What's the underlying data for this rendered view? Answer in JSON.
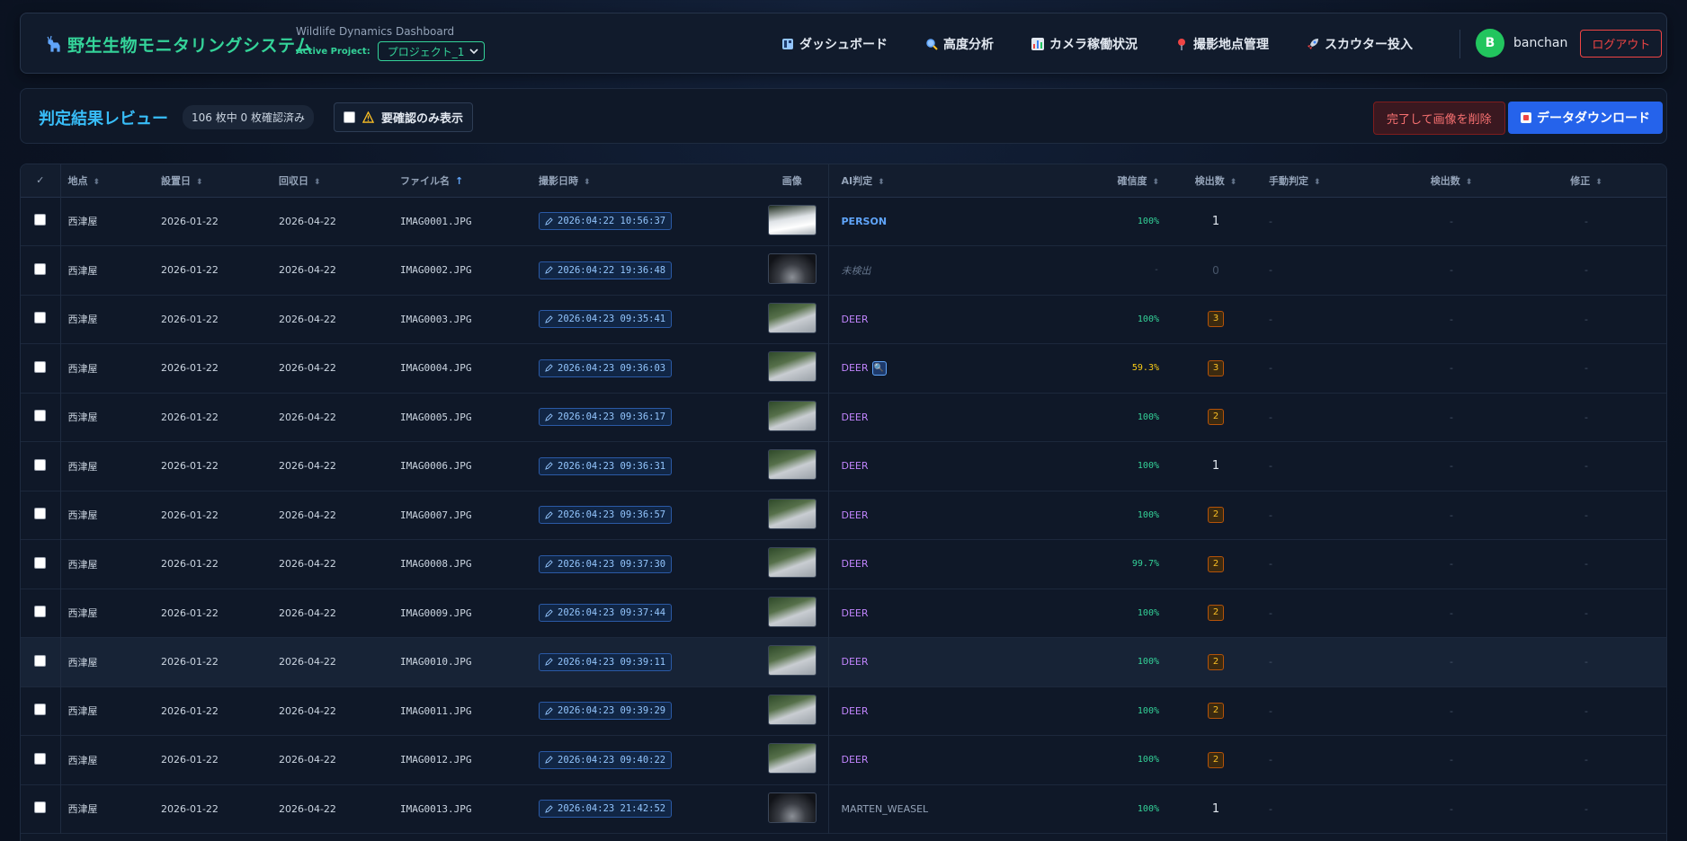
{
  "header": {
    "brand_title": "野生生物モニタリングシステム",
    "subtitle": "Wildlife Dynamics Dashboard",
    "project_label": "Active Project:",
    "project_value": "プロジェクト_1",
    "nav": [
      {
        "label": "ダッシュボード",
        "icon": "dashboard-icon"
      },
      {
        "label": "高度分析",
        "icon": "magnifier-icon"
      },
      {
        "label": "カメラ稼働状況",
        "icon": "bar-chart-icon"
      },
      {
        "label": "撮影地点管理",
        "icon": "location-pin-icon"
      },
      {
        "label": "スカウター投入",
        "icon": "rocket-icon"
      }
    ],
    "avatar_initial": "B",
    "username": "banchan",
    "logout_label": "ログアウト"
  },
  "toolbar": {
    "title": "判定結果レビュー",
    "count_text": "106 枚中 0 枚確認済み",
    "filter_label": "要確認のみ表示",
    "delete_label": "完了して画像を削除",
    "download_label": "データダウンロード"
  },
  "table": {
    "columns": {
      "check": "✓",
      "location": "地点",
      "install_date": "設置日",
      "collect_date": "回収日",
      "filename": "ファイル名",
      "shot_time": "撮影日時",
      "image": "画像",
      "ai": "AI判定",
      "confidence": "確信度",
      "detections": "検出数",
      "manual": "手動判定",
      "manual_detections": "検出数",
      "fix": "修正"
    },
    "rows": [
      {
        "location": "西津屋",
        "install": "2026-01-22",
        "collect": "2026-04-22",
        "file": "IMAG0001.JPG",
        "time": "2026:04:22 10:56:37",
        "thumb": "light",
        "ai": "PERSON",
        "ai_class": "ai-person",
        "conf": "100%",
        "conf_class": "conf-hi",
        "count": "1",
        "count_type": "plain",
        "manual": "-",
        "manual_count": "-",
        "fix": "-"
      },
      {
        "location": "西津屋",
        "install": "2026-01-22",
        "collect": "2026-04-22",
        "file": "IMAG0002.JPG",
        "time": "2026:04:22 19:36:48",
        "thumb": "night",
        "ai": "未検出",
        "ai_class": "ai-none",
        "conf": "-",
        "conf_class": "conf-none",
        "count": "0",
        "count_type": "zero",
        "manual": "-",
        "manual_count": "-",
        "fix": "-"
      },
      {
        "location": "西津屋",
        "install": "2026-01-22",
        "collect": "2026-04-22",
        "file": "IMAG0003.JPG",
        "time": "2026:04:23 09:35:41",
        "thumb": "day",
        "ai": "DEER",
        "ai_class": "ai-deer",
        "conf": "100%",
        "conf_class": "conf-hi",
        "count": "3",
        "count_type": "badge",
        "manual": "-",
        "manual_count": "-",
        "fix": "-"
      },
      {
        "location": "西津屋",
        "install": "2026-01-22",
        "collect": "2026-04-22",
        "file": "IMAG0004.JPG",
        "time": "2026:04:23 09:36:03",
        "thumb": "day",
        "ai": "DEER",
        "ai_class": "ai-deer",
        "zoom": true,
        "conf": "59.3%",
        "conf_class": "conf-mid",
        "count": "3",
        "count_type": "badge",
        "manual": "-",
        "manual_count": "-",
        "fix": "-"
      },
      {
        "location": "西津屋",
        "install": "2026-01-22",
        "collect": "2026-04-22",
        "file": "IMAG0005.JPG",
        "time": "2026:04:23 09:36:17",
        "thumb": "day",
        "ai": "DEER",
        "ai_class": "ai-deer",
        "conf": "100%",
        "conf_class": "conf-hi",
        "count": "2",
        "count_type": "badge",
        "manual": "-",
        "manual_count": "-",
        "fix": "-"
      },
      {
        "location": "西津屋",
        "install": "2026-01-22",
        "collect": "2026-04-22",
        "file": "IMAG0006.JPG",
        "time": "2026:04:23 09:36:31",
        "thumb": "day",
        "ai": "DEER",
        "ai_class": "ai-deer",
        "conf": "100%",
        "conf_class": "conf-hi",
        "count": "1",
        "count_type": "plain",
        "manual": "-",
        "manual_count": "-",
        "fix": "-"
      },
      {
        "location": "西津屋",
        "install": "2026-01-22",
        "collect": "2026-04-22",
        "file": "IMAG0007.JPG",
        "time": "2026:04:23 09:36:57",
        "thumb": "day",
        "ai": "DEER",
        "ai_class": "ai-deer",
        "conf": "100%",
        "conf_class": "conf-hi",
        "count": "2",
        "count_type": "badge",
        "manual": "-",
        "manual_count": "-",
        "fix": "-"
      },
      {
        "location": "西津屋",
        "install": "2026-01-22",
        "collect": "2026-04-22",
        "file": "IMAG0008.JPG",
        "time": "2026:04:23 09:37:30",
        "thumb": "day",
        "ai": "DEER",
        "ai_class": "ai-deer",
        "conf": "99.7%",
        "conf_class": "conf-hi",
        "count": "2",
        "count_type": "badge",
        "manual": "-",
        "manual_count": "-",
        "fix": "-"
      },
      {
        "location": "西津屋",
        "install": "2026-01-22",
        "collect": "2026-04-22",
        "file": "IMAG0009.JPG",
        "time": "2026:04:23 09:37:44",
        "thumb": "day",
        "ai": "DEER",
        "ai_class": "ai-deer",
        "conf": "100%",
        "conf_class": "conf-hi",
        "count": "2",
        "count_type": "badge",
        "manual": "-",
        "manual_count": "-",
        "fix": "-"
      },
      {
        "location": "西津屋",
        "install": "2026-01-22",
        "collect": "2026-04-22",
        "file": "IMAG0010.JPG",
        "time": "2026:04:23 09:39:11",
        "thumb": "day",
        "ai": "DEER",
        "ai_class": "ai-deer",
        "conf": "100%",
        "conf_class": "conf-hi",
        "count": "2",
        "count_type": "badge",
        "manual": "-",
        "manual_count": "-",
        "fix": "-",
        "highlight": true
      },
      {
        "location": "西津屋",
        "install": "2026-01-22",
        "collect": "2026-04-22",
        "file": "IMAG0011.JPG",
        "time": "2026:04:23 09:39:29",
        "thumb": "day",
        "ai": "DEER",
        "ai_class": "ai-deer",
        "conf": "100%",
        "conf_class": "conf-hi",
        "count": "2",
        "count_type": "badge",
        "manual": "-",
        "manual_count": "-",
        "fix": "-"
      },
      {
        "location": "西津屋",
        "install": "2026-01-22",
        "collect": "2026-04-22",
        "file": "IMAG0012.JPG",
        "time": "2026:04:23 09:40:22",
        "thumb": "day",
        "ai": "DEER",
        "ai_class": "ai-deer",
        "conf": "100%",
        "conf_class": "conf-hi",
        "count": "2",
        "count_type": "badge",
        "manual": "-",
        "manual_count": "-",
        "fix": "-"
      },
      {
        "location": "西津屋",
        "install": "2026-01-22",
        "collect": "2026-04-22",
        "file": "IMAG0013.JPG",
        "time": "2026:04:23 21:42:52",
        "thumb": "night",
        "ai": "MARTEN_WEASEL",
        "ai_class": "ai-marten",
        "conf": "100%",
        "conf_class": "conf-hi",
        "count": "1",
        "count_type": "plain",
        "manual": "-",
        "manual_count": "-",
        "fix": "-"
      }
    ]
  }
}
